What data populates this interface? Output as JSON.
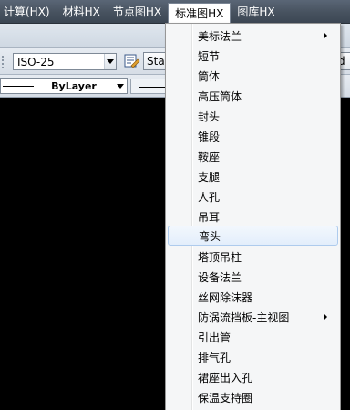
{
  "menubar": {
    "items": [
      {
        "label": "计算(HX)"
      },
      {
        "label": "材料HX"
      },
      {
        "label": "节点图HX"
      },
      {
        "label": "标准图HX",
        "active": true
      },
      {
        "label": "图库HX"
      }
    ]
  },
  "toolbar": {
    "dimstyle_value": "ISO-25",
    "text_style_partial": "Sta",
    "right_partial": "d",
    "linetype_value": "ByLayer"
  },
  "dropdown": {
    "items": [
      {
        "label": "美标法兰",
        "has_submenu": true
      },
      {
        "label": "短节"
      },
      {
        "label": "筒体"
      },
      {
        "label": "高压筒体"
      },
      {
        "label": "封头"
      },
      {
        "label": "锥段"
      },
      {
        "label": "鞍座"
      },
      {
        "label": "支腿"
      },
      {
        "label": "人孔"
      },
      {
        "label": "吊耳"
      },
      {
        "label": "弯头",
        "highlighted": true
      },
      {
        "label": "塔顶吊柱"
      },
      {
        "label": "设备法兰"
      },
      {
        "label": "丝网除沫器"
      },
      {
        "label": "防涡流挡板-主视图",
        "has_submenu": true
      },
      {
        "label": "引出管"
      },
      {
        "label": "排气孔"
      },
      {
        "label": "裙座出入孔"
      },
      {
        "label": "保温支持圈"
      }
    ]
  },
  "colors": {
    "canvas": "#000000",
    "menubar": "#47525f",
    "menu_bg": "#f5f6f7",
    "menu_hover_border": "#aecbed"
  }
}
